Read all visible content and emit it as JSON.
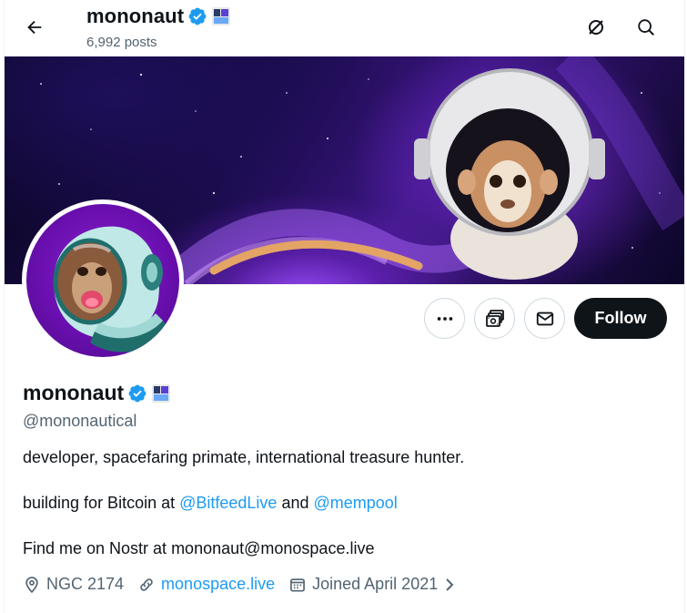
{
  "header": {
    "back_icon": "arrow-left-icon",
    "display_name": "mononaut",
    "posts_count": "6,992 posts",
    "refresh_icon": "circle-slash-icon",
    "search_icon": "search-icon"
  },
  "banner": {
    "description_icon": "banner-image"
  },
  "profile": {
    "display_name": "mononaut",
    "handle": "@mononautical",
    "verified_icon": "verified-badge-icon",
    "affiliate_icon": "affiliate-badge-icon",
    "avatar_icon": "avatar-image"
  },
  "actions": {
    "more_icon": "more-icon",
    "subscribe_icon": "money-icon",
    "message_icon": "envelope-icon",
    "follow_label": "Follow"
  },
  "bio": {
    "line1": "developer, spacefaring primate, international treasure hunter.",
    "line2_prefix": "building for Bitcoin at ",
    "line2_link1": "@BitfeedLive",
    "line2_middle": " and ",
    "line2_link2": "@mempool",
    "line3": "Find me on Nostr at mononaut@monospace.live"
  },
  "meta": {
    "location": "NGC 2174",
    "website": "monospace.live",
    "joined": "Joined April 2021"
  },
  "colors": {
    "accent": "#1d9bf0",
    "text": "#0f1419",
    "muted": "#536471",
    "follow_bg": "#0f1419",
    "border": "#cfd9de"
  }
}
